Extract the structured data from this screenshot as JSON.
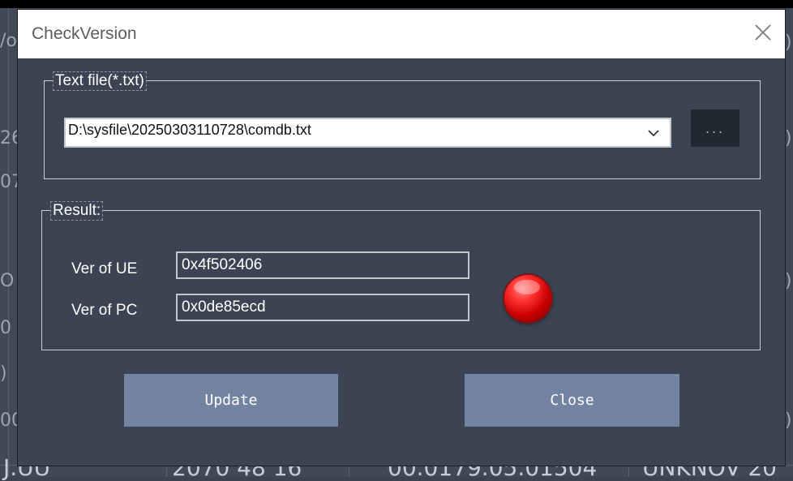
{
  "window": {
    "title": "CheckVersion",
    "close_icon": "close-icon"
  },
  "text_file_group": {
    "legend": "Text file(*.txt)",
    "path_value": "D:\\sysfile\\20250303110728\\comdb.txt",
    "dropdown_icon": "chevron-down-icon",
    "browse_label": "..."
  },
  "result_group": {
    "legend": "Result:",
    "ver_ue_label": "Ver of UE",
    "ver_ue_value": "0x4f502406",
    "ver_pc_label": "Ver of PC",
    "ver_pc_value": "0x0de85ecd",
    "status_indicator": "red"
  },
  "buttons": {
    "update_label": "Update",
    "close_label": "Close"
  },
  "background": {
    "bottom_texts": [
      "J.UU",
      "2070 48 16",
      "00.0179.05.01504",
      "UNKNOV 20"
    ]
  },
  "colors": {
    "dialog_bg": "#3b4453",
    "button_bg": "#7384a3",
    "led_red": "#e01a1a"
  }
}
